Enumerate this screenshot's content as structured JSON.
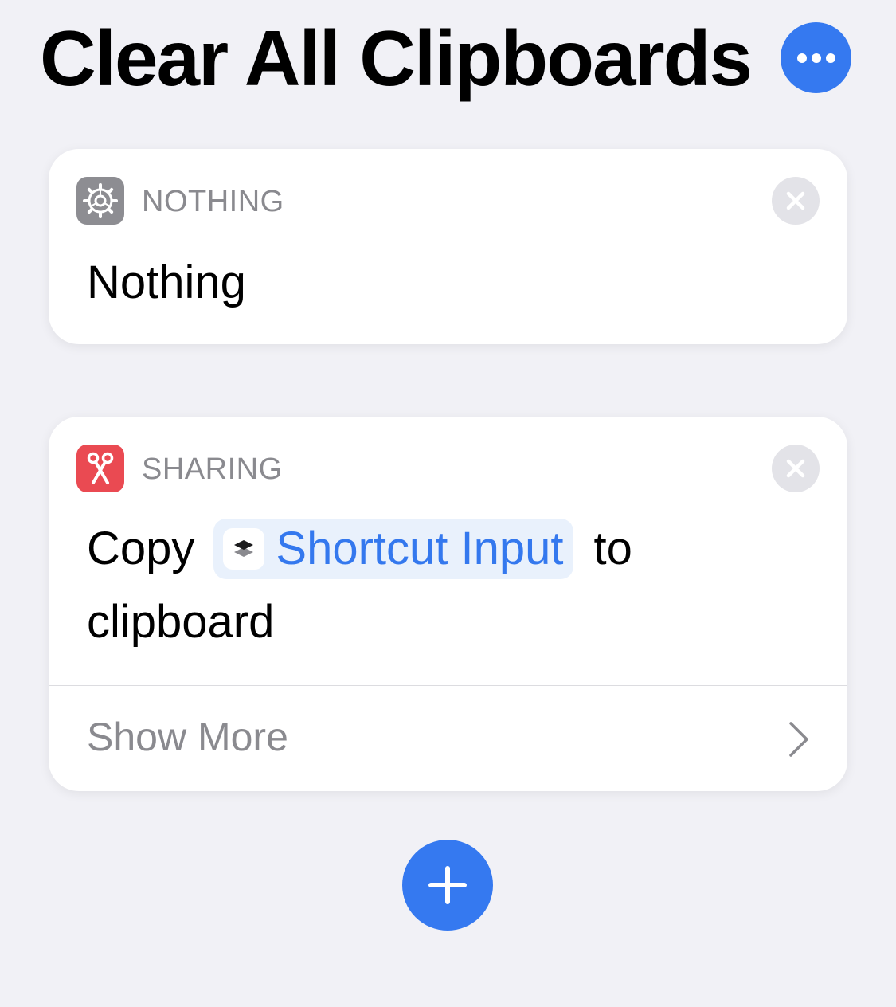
{
  "header": {
    "title": "Clear All Clipboards",
    "more_icon": "ellipsis-icon"
  },
  "actions": [
    {
      "category": "NOTHING",
      "category_icon": "gear-icon",
      "category_color": "#8d8d92",
      "title": "Nothing"
    },
    {
      "category": "SHARING",
      "category_icon": "scissors-icon",
      "category_color": "#ea4a52",
      "text_before": "Copy",
      "token": {
        "label": "Shortcut Input",
        "icon": "shortcuts-stack-icon",
        "color": "#3478ee"
      },
      "text_after": "to",
      "text_line2": "clipboard",
      "show_more": "Show More"
    }
  ],
  "add_icon": "plus-icon",
  "colors": {
    "accent": "#3579f0",
    "background": "#f1f1f6"
  }
}
